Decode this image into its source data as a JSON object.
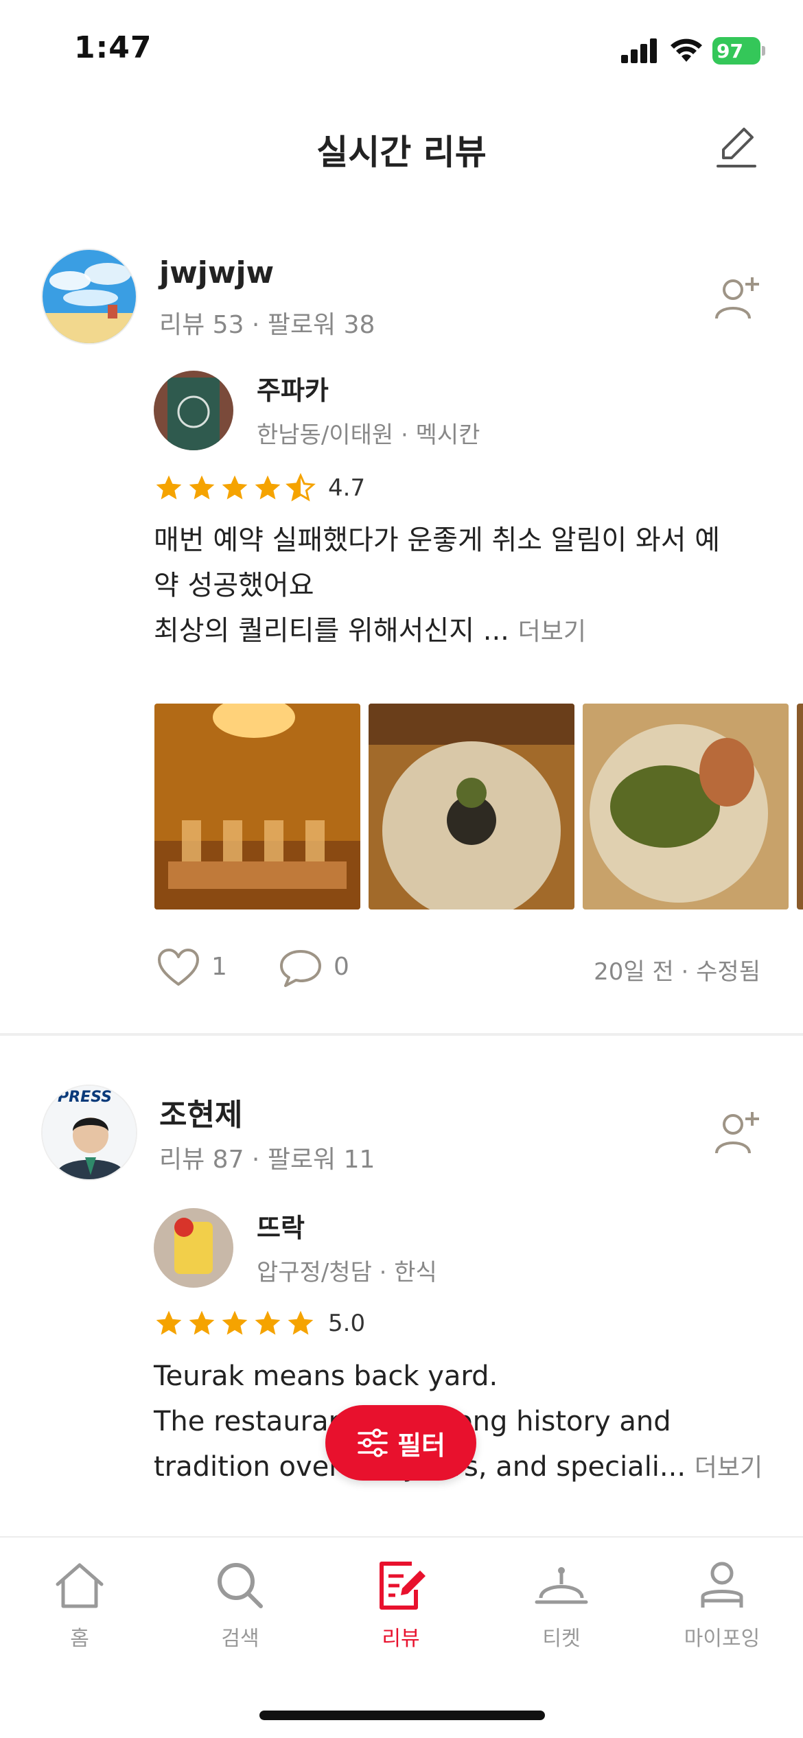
{
  "status_bar": {
    "time": "1:47",
    "battery": "97"
  },
  "header": {
    "title": "실시간 리뷰"
  },
  "reviews": [
    {
      "user_name": "jwjwjw",
      "user_stats": "리뷰 53 · 팔로워 38",
      "restaurant_name": "주파카",
      "restaurant_meta": "한남동/이태원 · 멕시칸",
      "rating": "4.7",
      "text_lines": [
        "매번 예약 실패했다가 운좋게 취소 알림이 와서 예",
        "약 성공했어요",
        "최상의 퀄리티를 위해서신지 ..."
      ],
      "more_label": "더보기",
      "likes": "1",
      "comments": "0",
      "date": "20일 전 · 수정됨"
    },
    {
      "user_name": "조현제",
      "user_stats": "리뷰 87 · 팔로워 11",
      "avatar_text": "PRESS",
      "restaurant_name": "뜨락",
      "restaurant_meta": "압구정/청담 · 한식",
      "rating": "5.0",
      "text_lines": [
        "Teurak means back yard.",
        "The restaurant has a long history and",
        "tradition over the years, and speciali..."
      ],
      "more_label": "더보기"
    }
  ],
  "filter_button": {
    "label": "필터"
  },
  "tabs": [
    {
      "label": "홈",
      "icon": "home-icon"
    },
    {
      "label": "검색",
      "icon": "search-icon"
    },
    {
      "label": "리뷰",
      "icon": "review-icon",
      "active": true
    },
    {
      "label": "티켓",
      "icon": "ticket-icon"
    },
    {
      "label": "마이포잉",
      "icon": "profile-icon"
    }
  ],
  "colors": {
    "accent": "#e8112d",
    "star": "#f5a300",
    "muted": "#888888"
  }
}
